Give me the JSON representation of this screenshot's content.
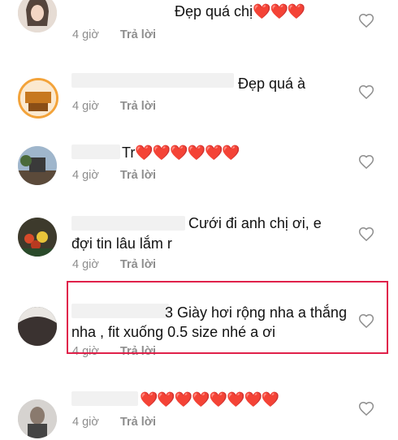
{
  "colors": {
    "highlight": "#e0214a",
    "heart": "#e53935",
    "meta": "#8e8e8e"
  },
  "comments": [
    {
      "text": "Đẹp quá chị",
      "hearts": "❤️❤️❤️",
      "time": "4 giờ",
      "reply": "Trả lời",
      "avatar": "avatar-woman",
      "like_icon": "heart-outline-icon"
    },
    {
      "text": "Đẹp quá à",
      "hearts": "",
      "time": "4 giờ",
      "reply": "Trả lời",
      "avatar": "avatar-shop-logo",
      "like_icon": "heart-outline-icon"
    },
    {
      "text": "Tr",
      "hearts": "❤️❤️❤️❤️❤️❤️",
      "time": "4 giờ",
      "reply": "Trả lời",
      "avatar": "avatar-outdoor",
      "like_icon": "heart-outline-icon"
    },
    {
      "text": "Cưới đi anh chị ơi, e",
      "text2": "đợi tin lâu lắm r",
      "hearts": "",
      "time": "4 giờ",
      "reply": "Trả lời",
      "avatar": "avatar-flowers",
      "like_icon": "heart-outline-icon"
    },
    {
      "text": "3 Giày hơi rộng nha a thắng",
      "text2": "nha , fit xuống 0.5 size nhé a ơi",
      "hearts": "",
      "time": "4 giờ",
      "reply": "Trả lời",
      "avatar": "avatar-dark",
      "like_icon": "heart-outline-icon",
      "highlighted": true
    },
    {
      "text": "",
      "hearts": "❤️❤️❤️❤️❤️❤️❤️❤️",
      "time": "4 giờ",
      "reply": "Trả lời",
      "avatar": "avatar-person",
      "like_icon": "heart-outline-icon"
    }
  ]
}
